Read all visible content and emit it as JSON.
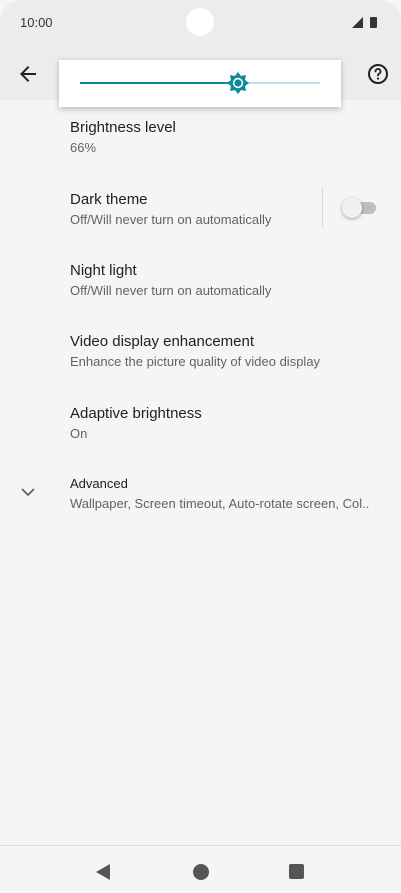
{
  "status_bar": {
    "time": "10:00"
  },
  "app_bar": {
    "back_icon": "arrow-back-icon",
    "help_icon": "help-circle-icon"
  },
  "brightness_slider": {
    "level": 0.66,
    "thumb_icon": "brightness-sun-icon"
  },
  "settings": {
    "brightness": {
      "title": "Brightness level",
      "summary": "66%"
    },
    "dark_theme": {
      "title": "Dark theme",
      "summary": "Off/Will never turn on automatically",
      "enabled": false
    },
    "night_light": {
      "title": "Night light",
      "summary": "Off/Will never turn on automatically"
    },
    "video_enhancement": {
      "title": "Video display enhancement",
      "summary": "Enhance the picture quality of video display"
    },
    "adaptive_brightness": {
      "title": "Adaptive brightness",
      "summary": "On"
    },
    "advanced": {
      "title": "Advanced",
      "summary": "Wallpaper, Screen timeout, Auto-rotate screen, Col.."
    }
  },
  "nav_bar": {
    "back_icon": "triangle-back-icon",
    "home_icon": "circle-home-icon",
    "recents_icon": "square-recents-icon"
  },
  "colors": {
    "accent": "#0b8a99",
    "accent_light": "#b8e3e6",
    "background": "#f5f5f5",
    "appbar": "#ececec"
  }
}
